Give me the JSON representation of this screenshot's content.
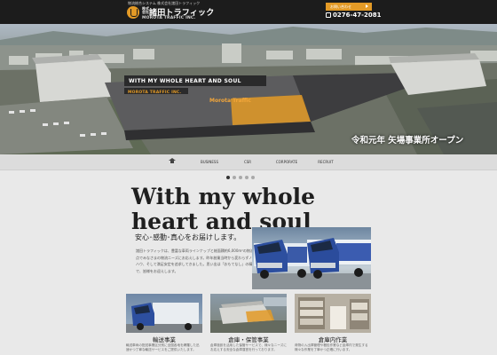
{
  "header": {
    "tagline": "物流総合システム 株式会社諸田トラフィック",
    "corp_type": "株式会社",
    "brand": "諸田トラフィック",
    "brand_en": "MOROTA TRAFFIC INC.",
    "contact_label": "お問い合わせ",
    "phone": "0276-47-2081",
    "accent": "#e39a26",
    "bar_color": "#1c1c1c"
  },
  "hero": {
    "slogan": "WITH MY WHOLE HEART AND SOUL",
    "company": "MOROTA TRAFFIC INC.",
    "sign": "Morota Traffic",
    "caption": "令和元年 矢場事業所オープン"
  },
  "nav": {
    "home_icon": "home-icon",
    "items": [
      "BUSINESS",
      "CSR",
      "CORPORATE",
      "RECRUIT"
    ]
  },
  "slider": {
    "count": 5,
    "active": 1
  },
  "main": {
    "headline_1": "With my whole",
    "headline_2": "heart and soul",
    "subhead": "安心･感動･真心をお届けします。",
    "body": "諸田トラフィックは、豊富な車両ラインナップと総面積約6,000m²の物流拠点でみなさまの物流ニーズにお応えします。昨年創業当時から変わらずノウハウ、そして満足安定を追求してきました。思い出は「おもてなし」の精神で、皆様をお迎えします。"
  },
  "cards": [
    {
      "title": "輸送事業",
      "text": "輸送車両の配送事業区分別に全国各地を網羅した迅速かつ丁寧な輸送サービスをご提供いたします。"
    },
    {
      "title": "倉庫・保管事業",
      "text": "倉庫施設を活用した保管サービスで、様々なニーズにお応えする安全な倉庫運営を行っております。"
    },
    {
      "title": "倉庫内作業",
      "text": "荷物の入出庫管理や梱包作業など倉庫内で発生する様々な作業を丁寧かつ正確に行います。"
    }
  ]
}
